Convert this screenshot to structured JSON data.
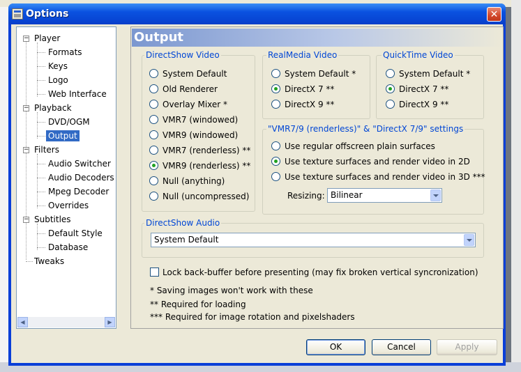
{
  "window": {
    "title": "Options",
    "close_glyph": "✕"
  },
  "tree": {
    "items": [
      {
        "label": "Player",
        "level": 0,
        "expander": "−"
      },
      {
        "label": "Formats",
        "level": 1
      },
      {
        "label": "Keys",
        "level": 1
      },
      {
        "label": "Logo",
        "level": 1
      },
      {
        "label": "Web Interface",
        "level": 1
      },
      {
        "label": "Playback",
        "level": 0,
        "expander": "−"
      },
      {
        "label": "DVD/OGM",
        "level": 1
      },
      {
        "label": "Output",
        "level": 1,
        "selected": true
      },
      {
        "label": "Filters",
        "level": 0,
        "expander": "−"
      },
      {
        "label": "Audio Switcher",
        "level": 1
      },
      {
        "label": "Audio Decoders",
        "level": 1
      },
      {
        "label": "Mpeg Decoder",
        "level": 1
      },
      {
        "label": "Overrides",
        "level": 1
      },
      {
        "label": "Subtitles",
        "level": 0,
        "expander": "−"
      },
      {
        "label": "Default Style",
        "level": 1
      },
      {
        "label": "Database",
        "level": 1
      },
      {
        "label": "Tweaks",
        "level": 0
      }
    ],
    "scroll_left_icon": "◀",
    "scroll_right_icon": "▶"
  },
  "panel": {
    "title": "Output",
    "directshow_video": {
      "label": "DirectShow Video",
      "options": [
        {
          "label": "System Default",
          "checked": false
        },
        {
          "label": "Old Renderer",
          "checked": false
        },
        {
          "label": "Overlay Mixer *",
          "checked": false
        },
        {
          "label": "VMR7 (windowed)",
          "checked": false
        },
        {
          "label": "VMR9 (windowed)",
          "checked": false
        },
        {
          "label": "VMR7 (renderless) **",
          "checked": false
        },
        {
          "label": "VMR9 (renderless) **",
          "checked": true
        },
        {
          "label": "Null (anything)",
          "checked": false
        },
        {
          "label": "Null (uncompressed)",
          "checked": false
        }
      ]
    },
    "realmedia_video": {
      "label": "RealMedia Video",
      "options": [
        {
          "label": "System Default *",
          "checked": false
        },
        {
          "label": "DirectX 7 **",
          "checked": true
        },
        {
          "label": "DirectX 9 **",
          "checked": false
        }
      ]
    },
    "quicktime_video": {
      "label": "QuickTime Video",
      "options": [
        {
          "label": "System Default *",
          "checked": false
        },
        {
          "label": "DirectX 7 **",
          "checked": true
        },
        {
          "label": "DirectX 9 **",
          "checked": false
        }
      ]
    },
    "vmr_settings": {
      "label": "\"VMR7/9 (renderless)\" & \"DirectX 7/9\" settings",
      "options": [
        {
          "label": "Use regular offscreen plain surfaces",
          "checked": false
        },
        {
          "label": "Use texture surfaces and render video in 2D",
          "checked": true
        },
        {
          "label": "Use texture surfaces and render video in 3D ***",
          "checked": false
        }
      ],
      "resizing_label": "Resizing:",
      "resizing_value": "Bilinear"
    },
    "directshow_audio": {
      "label": "DirectShow Audio",
      "value": "System Default"
    },
    "lock_backbuffer": {
      "label": "Lock back-buffer before presenting (may fix broken vertical syncronization)",
      "checked": false
    },
    "notes": [
      "* Saving images won't work with these",
      "** Required for loading",
      "*** Required for image rotation and pixelshaders"
    ]
  },
  "buttons": {
    "ok": "OK",
    "cancel": "Cancel",
    "apply": "Apply"
  },
  "colors": {
    "titlebar": "#0a52e0",
    "group_label": "#0046d5",
    "selection": "#316ac5",
    "radio_dot": "#21a121"
  }
}
